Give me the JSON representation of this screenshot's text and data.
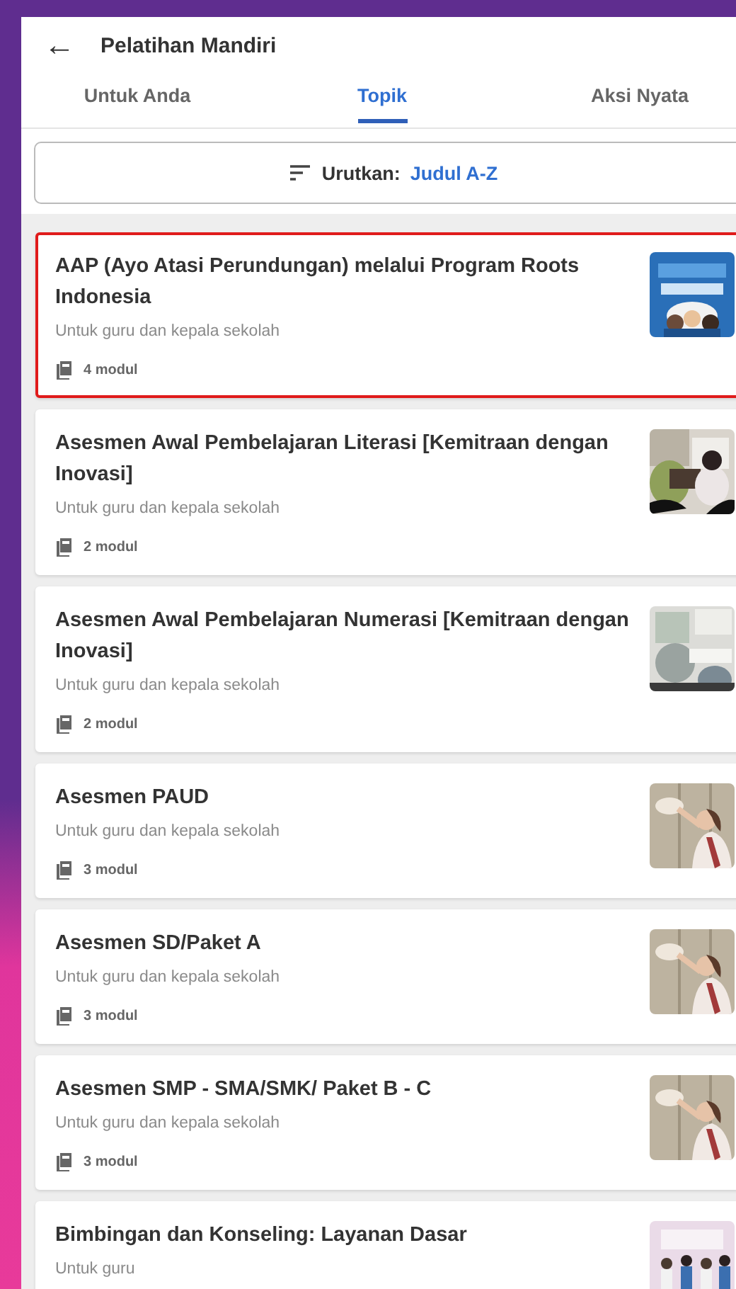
{
  "header": {
    "back_icon": "←",
    "title": "Pelatihan Mandiri"
  },
  "tabs": [
    {
      "label": "Untuk Anda",
      "selected": false
    },
    {
      "label": "Topik",
      "selected": true
    },
    {
      "label": "Aksi Nyata",
      "selected": false
    }
  ],
  "sort": {
    "label": "Urutkan:",
    "value": "Judul A-Z"
  },
  "topics": [
    {
      "title": "AAP (Ayo Atasi Perundungan) melalui Program Roots Indonesia",
      "audience": "Untuk guru dan kepala sekolah",
      "modules": "4 modul",
      "highlighted": true
    },
    {
      "title": "Asesmen Awal Pembelajaran Literasi [Kemitraan dengan Inovasi]",
      "audience": "Untuk guru dan kepala sekolah",
      "modules": "2 modul",
      "highlighted": false
    },
    {
      "title": "Asesmen Awal Pembelajaran Numerasi [Kemitraan dengan Inovasi]",
      "audience": "Untuk guru dan kepala sekolah",
      "modules": "2 modul",
      "highlighted": false
    },
    {
      "title": "Asesmen PAUD",
      "audience": "Untuk guru dan kepala sekolah",
      "modules": "3 modul",
      "highlighted": false
    },
    {
      "title": "Asesmen SD/Paket A",
      "audience": "Untuk guru dan kepala sekolah",
      "modules": "3 modul",
      "highlighted": false
    },
    {
      "title": "Asesmen SMP - SMA/SMK/ Paket B - C",
      "audience": "Untuk guru dan kepala sekolah",
      "modules": "3 modul",
      "highlighted": false
    },
    {
      "title": "Bimbingan dan Konseling: Layanan Dasar",
      "audience": "Untuk guru",
      "highlighted": false
    }
  ]
}
